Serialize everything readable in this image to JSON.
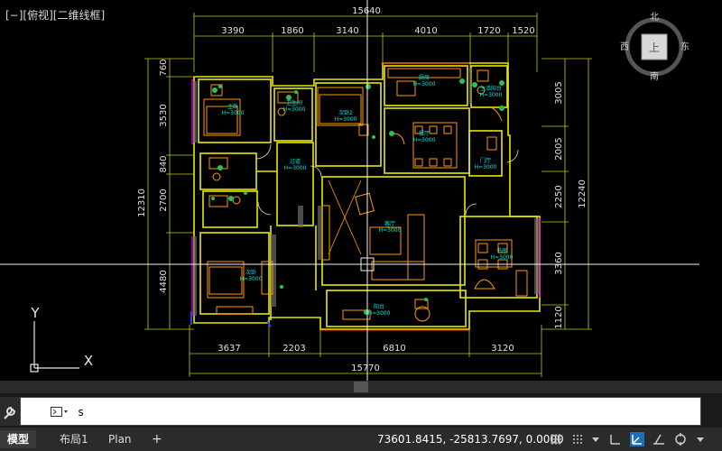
{
  "viewport": {
    "label": "[−][俯视][二维线框]"
  },
  "viewcube": {
    "north": "北",
    "south": "南",
    "east": "东",
    "west": "西",
    "face": "上"
  },
  "ucs": {
    "y": "Y",
    "x": "X"
  },
  "dimensions": {
    "top_total": "15640",
    "top": [
      "3390",
      "1860",
      "3140",
      "4010",
      "1720",
      "1520"
    ],
    "bottom": [
      "3637",
      "2203",
      "6810",
      "3120"
    ],
    "bottom_total": "15770",
    "left_total": "12310",
    "left": [
      "760",
      "3530",
      "840",
      "2700",
      "4480"
    ],
    "right_total": "12240",
    "right": [
      "3005",
      "2005",
      "2250",
      "3360",
      "1120"
    ]
  },
  "rooms": [
    {
      "name": "主卧",
      "h": "H=3000"
    },
    {
      "name": "卫生间",
      "h": "H=3000"
    },
    {
      "name": "次卧2",
      "h": "H=3000"
    },
    {
      "name": "厨房",
      "h": "H=3000"
    },
    {
      "name": "生活阳台",
      "h": "H=3000"
    },
    {
      "name": "餐厅",
      "h": "H=3000"
    },
    {
      "name": "过道",
      "h": "H=3000"
    },
    {
      "name": "门厅",
      "h": "H=3000"
    },
    {
      "name": "客厅",
      "h": "H=3000"
    },
    {
      "name": "书房",
      "h": "H=3000"
    },
    {
      "name": "次卧",
      "h": "H=3000"
    },
    {
      "name": "阳台",
      "h": "H=3000"
    }
  ],
  "command": {
    "value": "s"
  },
  "statusbar": {
    "tabs": [
      "模型",
      "布局1",
      "Plan"
    ],
    "add": "+",
    "coordinates": "73601.8415, -25813.7697, 0.0000"
  },
  "colors": {
    "wall": "#e8e800",
    "dim": "#c8c800",
    "text": "#00e5e5",
    "furniture": "#ff9a00",
    "magenta": "#ff00ff"
  }
}
